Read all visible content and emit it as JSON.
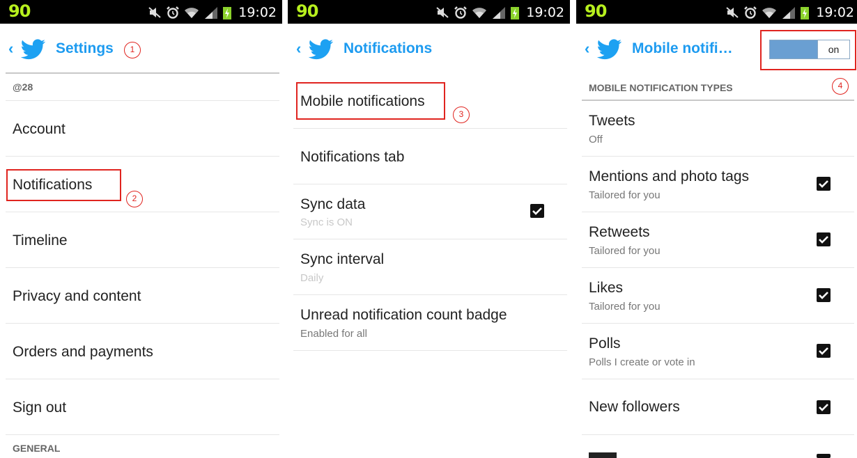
{
  "status_bar": {
    "number": "90",
    "time": "19:02"
  },
  "brand_color": "#1da1f2",
  "callout_color": "#e0241f",
  "panel1": {
    "back": "‹",
    "title": "Settings",
    "username": "@28",
    "items": [
      "Account",
      "Notifications",
      "Timeline",
      "Privacy and content",
      "Orders and payments",
      "Sign out"
    ],
    "section_general": "GENERAL",
    "callouts": [
      "1",
      "2"
    ]
  },
  "panel2": {
    "back": "‹",
    "title": "Notifications",
    "items": [
      {
        "label": "Mobile notifications"
      },
      {
        "label": "Notifications tab"
      },
      {
        "label": "Sync data",
        "sub": "Sync is ON",
        "checked": true
      },
      {
        "label": "Sync interval",
        "sub": "Daily"
      },
      {
        "label": "Unread notification count badge",
        "sub": "Enabled for all"
      }
    ],
    "callouts": [
      "3"
    ]
  },
  "panel3": {
    "back": "‹",
    "title": "Mobile notifi…",
    "toggle": "on",
    "section": "MOBILE NOTIFICATION TYPES",
    "items": [
      {
        "label": "Tweets",
        "sub": "Off"
      },
      {
        "label": "Mentions and photo tags",
        "sub": "Tailored for you",
        "checked": true
      },
      {
        "label": "Retweets",
        "sub": "Tailored for you",
        "checked": true
      },
      {
        "label": "Likes",
        "sub": "Tailored for you",
        "checked": true
      },
      {
        "label": "Polls",
        "sub": "Polls I create or vote in",
        "checked": true
      },
      {
        "label": "New followers",
        "checked": true
      }
    ],
    "callouts": [
      "4"
    ]
  }
}
